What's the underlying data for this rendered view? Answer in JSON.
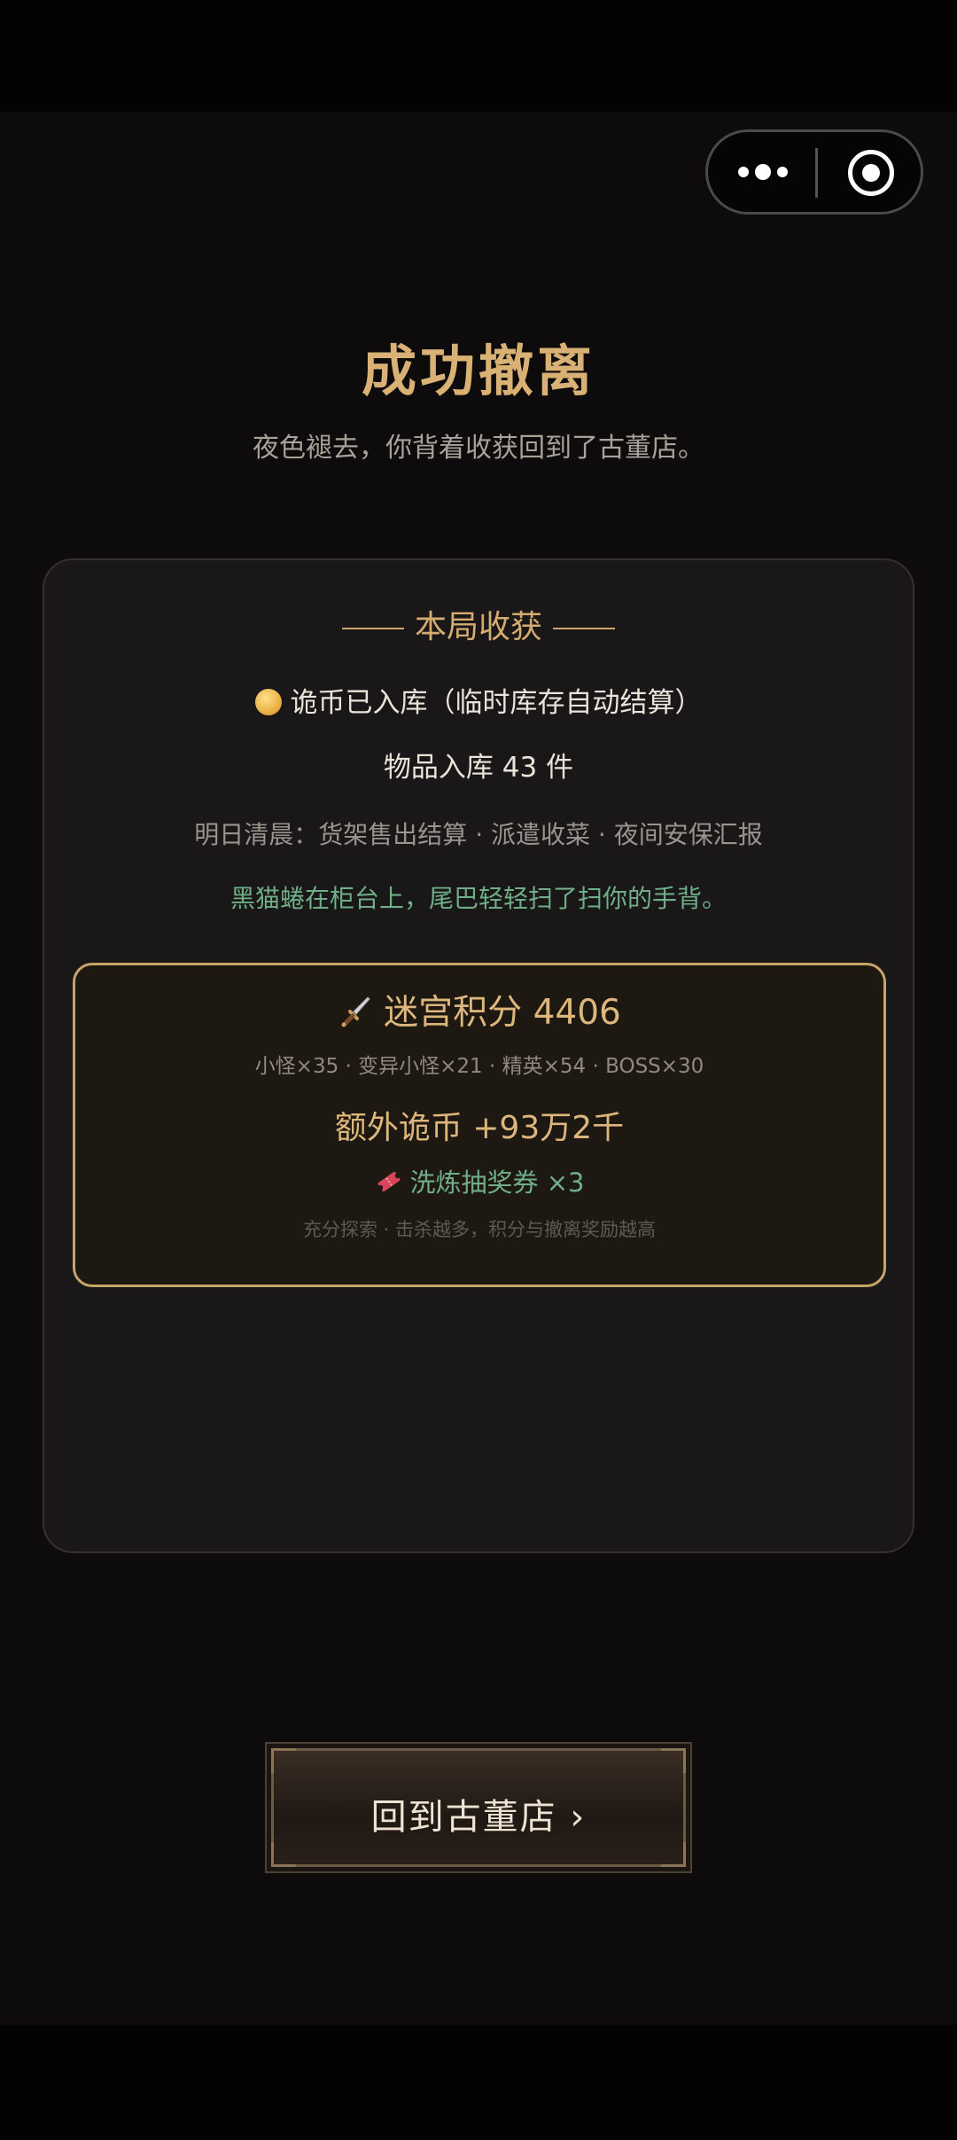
{
  "header": {
    "more_icon": "more-dots-icon",
    "close_icon": "target-circle-icon"
  },
  "result": {
    "title": "成功撤离",
    "subtitle": "夜色褪去，你背着收获回到了古董店。"
  },
  "haul": {
    "section_title": "本局收获",
    "coin_line": "诡币已入库（临时库存自动结算）",
    "items_line": "物品入库 43 件",
    "tomorrow_line": "明日清晨：货架售出结算 · 派遣收菜 · 夜间安保汇报",
    "cat_line": "黑猫蜷在柜台上，尾巴轻轻扫了扫你的手背。"
  },
  "score": {
    "title": "迷宫积分 4406",
    "kills": "小怪×35 · 变异小怪×21 · 精英×54 · BOSS×30",
    "extra_coin": "额外诡币 +93万2千",
    "ticket": "洗炼抽奖券 ×3",
    "hint": "充分探索 · 击杀越多，积分与撤离奖励越高"
  },
  "actions": {
    "return_label": "回到古董店 ›"
  },
  "colors": {
    "gold": "#d9b175",
    "green": "#6fae86",
    "background": "#0d0b0c"
  }
}
